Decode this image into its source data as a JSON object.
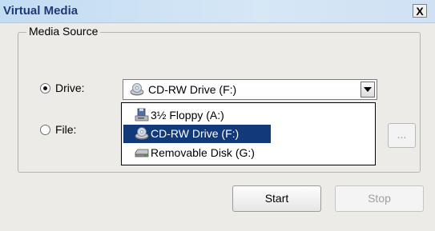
{
  "window": {
    "title": "Virtual Media",
    "close_glyph": "X"
  },
  "media_source": {
    "group_label": "Media Source",
    "drive_option": {
      "label": "Drive:",
      "selected": true
    },
    "file_option": {
      "label": "File:",
      "selected": false
    },
    "drive_select": {
      "value": "CD-RW Drive (F:)",
      "icon": "cd-drive-icon"
    },
    "drive_options": [
      {
        "label": "3½ Floppy (A:)",
        "icon": "floppy-drive-icon",
        "selected": false
      },
      {
        "label": "CD-RW Drive (F:)",
        "icon": "cd-drive-icon",
        "selected": true
      },
      {
        "label": "Removable Disk (G:)",
        "icon": "removable-disk-icon",
        "selected": false
      }
    ],
    "browse_label": "..."
  },
  "buttons": {
    "start_label": "Start",
    "stop_label": "Stop"
  },
  "colors": {
    "selection": "#123a7a",
    "title_text": "#203a78"
  }
}
